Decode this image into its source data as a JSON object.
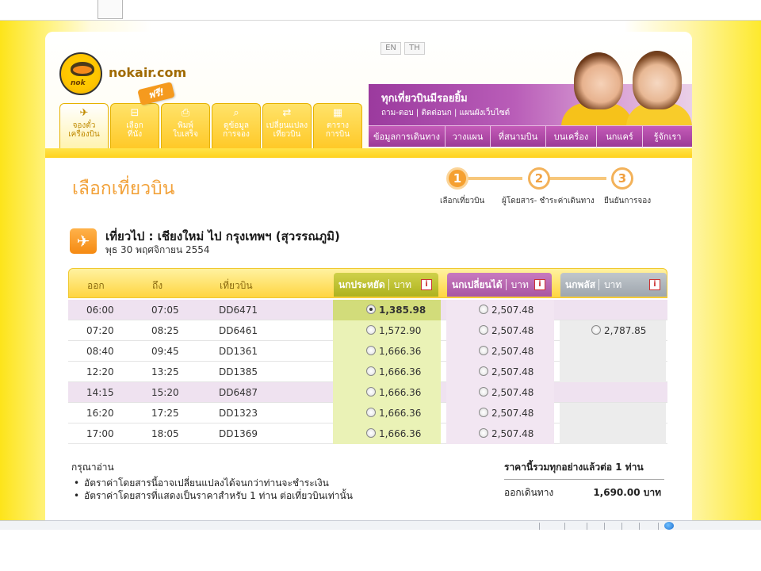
{
  "site": {
    "name": "nokair.com",
    "logo_text": "nok"
  },
  "lang": {
    "en": "EN",
    "th": "TH"
  },
  "free_tag": "ฟรี!",
  "main_tabs": [
    {
      "label_1": "จองตั๋ว",
      "label_2": "เครื่องบิน",
      "icon": "plane-icon",
      "glyph": "✈"
    },
    {
      "label_1": "เลือก",
      "label_2": "ที่นั่ง",
      "icon": "seat-icon",
      "glyph": "⊟"
    },
    {
      "label_1": "พิมพ์",
      "label_2": "ใบเสร็จ",
      "icon": "printer-icon",
      "glyph": "⎙"
    },
    {
      "label_1": "ดูข้อมูล",
      "label_2": "การจอง",
      "icon": "magnifier-icon",
      "glyph": "⌕"
    },
    {
      "label_1": "เปลี่ยนแปลง",
      "label_2": "เที่ยวบิน",
      "icon": "change-flight-icon",
      "glyph": "⇄"
    },
    {
      "label_1": "ตาราง",
      "label_2": "การบิน",
      "icon": "schedule-icon",
      "glyph": "▦"
    }
  ],
  "banner": {
    "title": "ทุกเที่ยวบินมีรอยยิ้ม",
    "subtitle": "ถาม-ตอบ | ติดต่อนก | แผนผังเว็บไซต์"
  },
  "sub_nav": [
    "ข้อมูลการเดินทาง",
    "วางแผน",
    "ที่สนามบิน",
    "บนเครื่อง",
    "นกแคร์",
    "รู้จักเรา"
  ],
  "page_title": "เลือกเที่ยวบิน",
  "steps": [
    {
      "num": "1",
      "label": "เลือกเที่ยวบิน",
      "state": "active"
    },
    {
      "num": "2",
      "label": "ผู้โดยสาร- ชำระค่าเดินทาง",
      "state": "idle"
    },
    {
      "num": "3",
      "label": "ยืนยันการจอง",
      "state": "idle"
    }
  ],
  "route": {
    "title": "เที่ยวไป : เชียงใหม่ ไป กรุงเทพฯ (สุวรรณภูมิ)",
    "date": "พุธ 30 พฤศจิกายน 2554"
  },
  "table": {
    "headers": {
      "depart": "ออก",
      "arrive": "ถึง",
      "flight": "เที่ยวบิน"
    },
    "fares": [
      {
        "name": "นกประหยัด",
        "unit": "บาท",
        "color": "#aeb21e"
      },
      {
        "name": "นกเปลี่ยนได้",
        "unit": "บาท",
        "color": "#a856a2"
      },
      {
        "name": "นกพลัส",
        "unit": "บาท",
        "color": "#9ea6ae"
      }
    ],
    "info_glyph": "i",
    "rows": [
      {
        "depart": "06:00",
        "arrive": "07:05",
        "flight": "DD6471",
        "saver": "1,385.98",
        "flexi": "2,507.48",
        "plus": "",
        "selected": true,
        "tint": true
      },
      {
        "depart": "07:20",
        "arrive": "08:25",
        "flight": "DD6461",
        "saver": "1,572.90",
        "flexi": "2,507.48",
        "plus": "2,787.85",
        "selected": false,
        "tint": false
      },
      {
        "depart": "08:40",
        "arrive": "09:45",
        "flight": "DD1361",
        "saver": "1,666.36",
        "flexi": "2,507.48",
        "plus": "",
        "selected": false,
        "tint": false
      },
      {
        "depart": "12:20",
        "arrive": "13:25",
        "flight": "DD1385",
        "saver": "1,666.36",
        "flexi": "2,507.48",
        "plus": "",
        "selected": false,
        "tint": false
      },
      {
        "depart": "14:15",
        "arrive": "15:20",
        "flight": "DD6487",
        "saver": "1,666.36",
        "flexi": "2,507.48",
        "plus": "",
        "selected": false,
        "tint": true
      },
      {
        "depart": "16:20",
        "arrive": "17:25",
        "flight": "DD1323",
        "saver": "1,666.36",
        "flexi": "2,507.48",
        "plus": "",
        "selected": false,
        "tint": false
      },
      {
        "depart": "17:00",
        "arrive": "18:05",
        "flight": "DD1369",
        "saver": "1,666.36",
        "flexi": "2,507.48",
        "plus": "",
        "selected": false,
        "tint": false
      }
    ]
  },
  "notes": {
    "title": "กรุณาอ่าน",
    "items": [
      "อัตราค่าโดยสารนี้อาจเปลี่ยนแปลงได้จนกว่าท่านจะชำระเงิน",
      "อัตราค่าโดยสารที่แสดงเป็นราคาสำหรับ 1 ท่าน ต่อเที่ยวบินเท่านั้น"
    ]
  },
  "total": {
    "title": "ราคานี้รวมทุกอย่างแล้วต่อ 1 ท่าน",
    "label": "ออกเดินทาง",
    "value": "1,690.00 บาท"
  },
  "colors": {
    "accent": "#f5a030",
    "brand_yellow": "#ffd21e",
    "brand_purple": "#9c3a97"
  }
}
